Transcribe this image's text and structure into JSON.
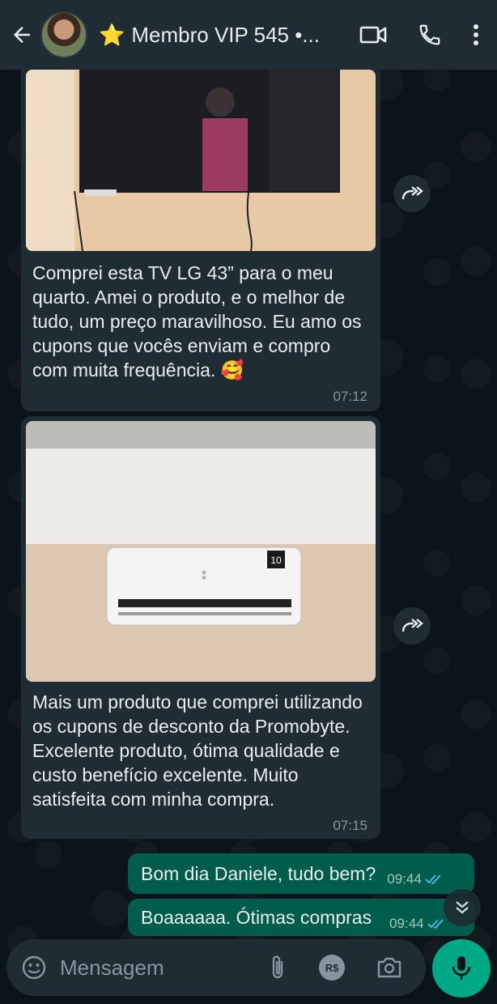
{
  "header": {
    "title_star": "⭐",
    "title": "Membro VIP 545 •...",
    "icons": [
      "back-arrow-icon",
      "avatar",
      "video-call-icon",
      "phone-icon",
      "more-vert-icon"
    ]
  },
  "messages": [
    {
      "type": "incoming-photo",
      "photo": "tv-on-wall",
      "text": "Comprei esta TV LG 43” para o meu quarto. Amei o produto, e o melhor de tudo, um preço maravilhoso. Eu amo os cupons que vocês enviam e compro com muita frequência. 🥰",
      "time": "07:12"
    },
    {
      "type": "incoming-photo",
      "photo": "air-conditioner",
      "ac_badge": "10",
      "text": "Mais um produto que comprei utilizando os cupons de desconto da Promobyte. Excelente produto, ótima qualidade e custo benefício excelente. Muito satisfeita com minha compra.",
      "time": "07:15"
    },
    {
      "type": "outgoing",
      "text": "Bom dia Daniele, tudo bem?",
      "time": "09:44",
      "status": "read"
    },
    {
      "type": "outgoing",
      "text": "Boaaaaaa. Ótimas compras",
      "time": "09:44",
      "status": "read"
    }
  ],
  "composer": {
    "placeholder": "Mensagem",
    "currency_label": "R$"
  },
  "colors": {
    "background": "#0b141a",
    "header": "#1f2c33",
    "incoming_bubble": "#1f2c33",
    "outgoing_bubble": "#005c4b",
    "accent": "#00a884",
    "read_ticks": "#53bdeb"
  }
}
